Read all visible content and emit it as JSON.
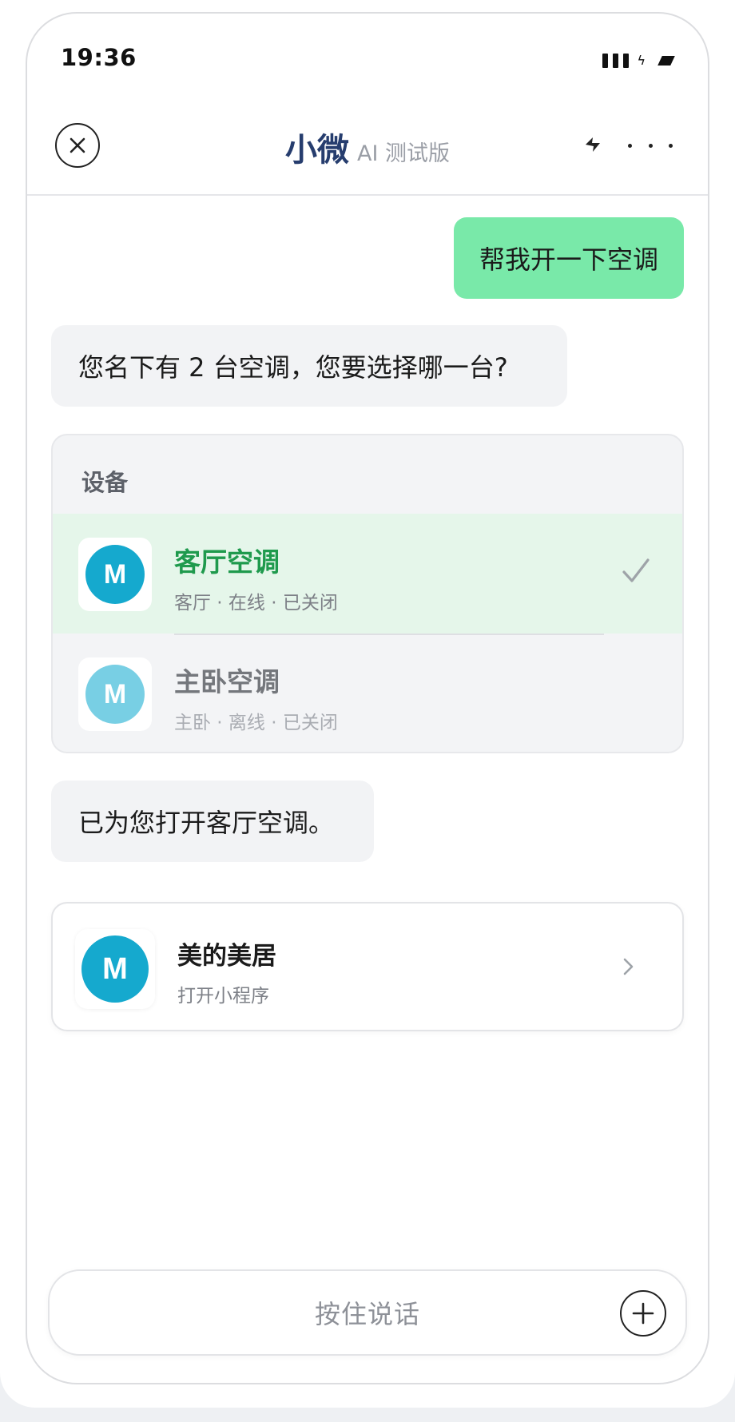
{
  "status_bar": {
    "time": "19:36"
  },
  "header": {
    "title": "小微",
    "subtitle": "AI 测试版",
    "close_icon": "close-icon",
    "flash_icon": "lightning-icon",
    "more_icon": "more-dots-icon"
  },
  "messages": {
    "user_text": "帮我开一下空调",
    "bot_question": "您名下有 2 台空调，您要选择哪一台?",
    "bot_confirm": "已为您打开客厅空调。"
  },
  "device_list": {
    "heading": "设备",
    "items": [
      {
        "name": "客厅空调",
        "meta": "客厅 · 在线 · 已关闭",
        "logo_letter": "M",
        "selected": true
      },
      {
        "name": "主卧空调",
        "meta": "主卧 · 离线 · 已关闭",
        "logo_letter": "M",
        "selected": false
      }
    ]
  },
  "mini_program": {
    "name": "美的美居",
    "subtitle": "打开小程序",
    "logo_letter": "M"
  },
  "input": {
    "voice_label": "按住说话"
  },
  "colors": {
    "title": "#263d6e",
    "user_bubble": "#79e9a9",
    "bot_bubble": "#f2f3f5",
    "selected_row": "#e5f6ea",
    "selected_text": "#1f9a4d",
    "brand_logo": "#15a9ce"
  }
}
